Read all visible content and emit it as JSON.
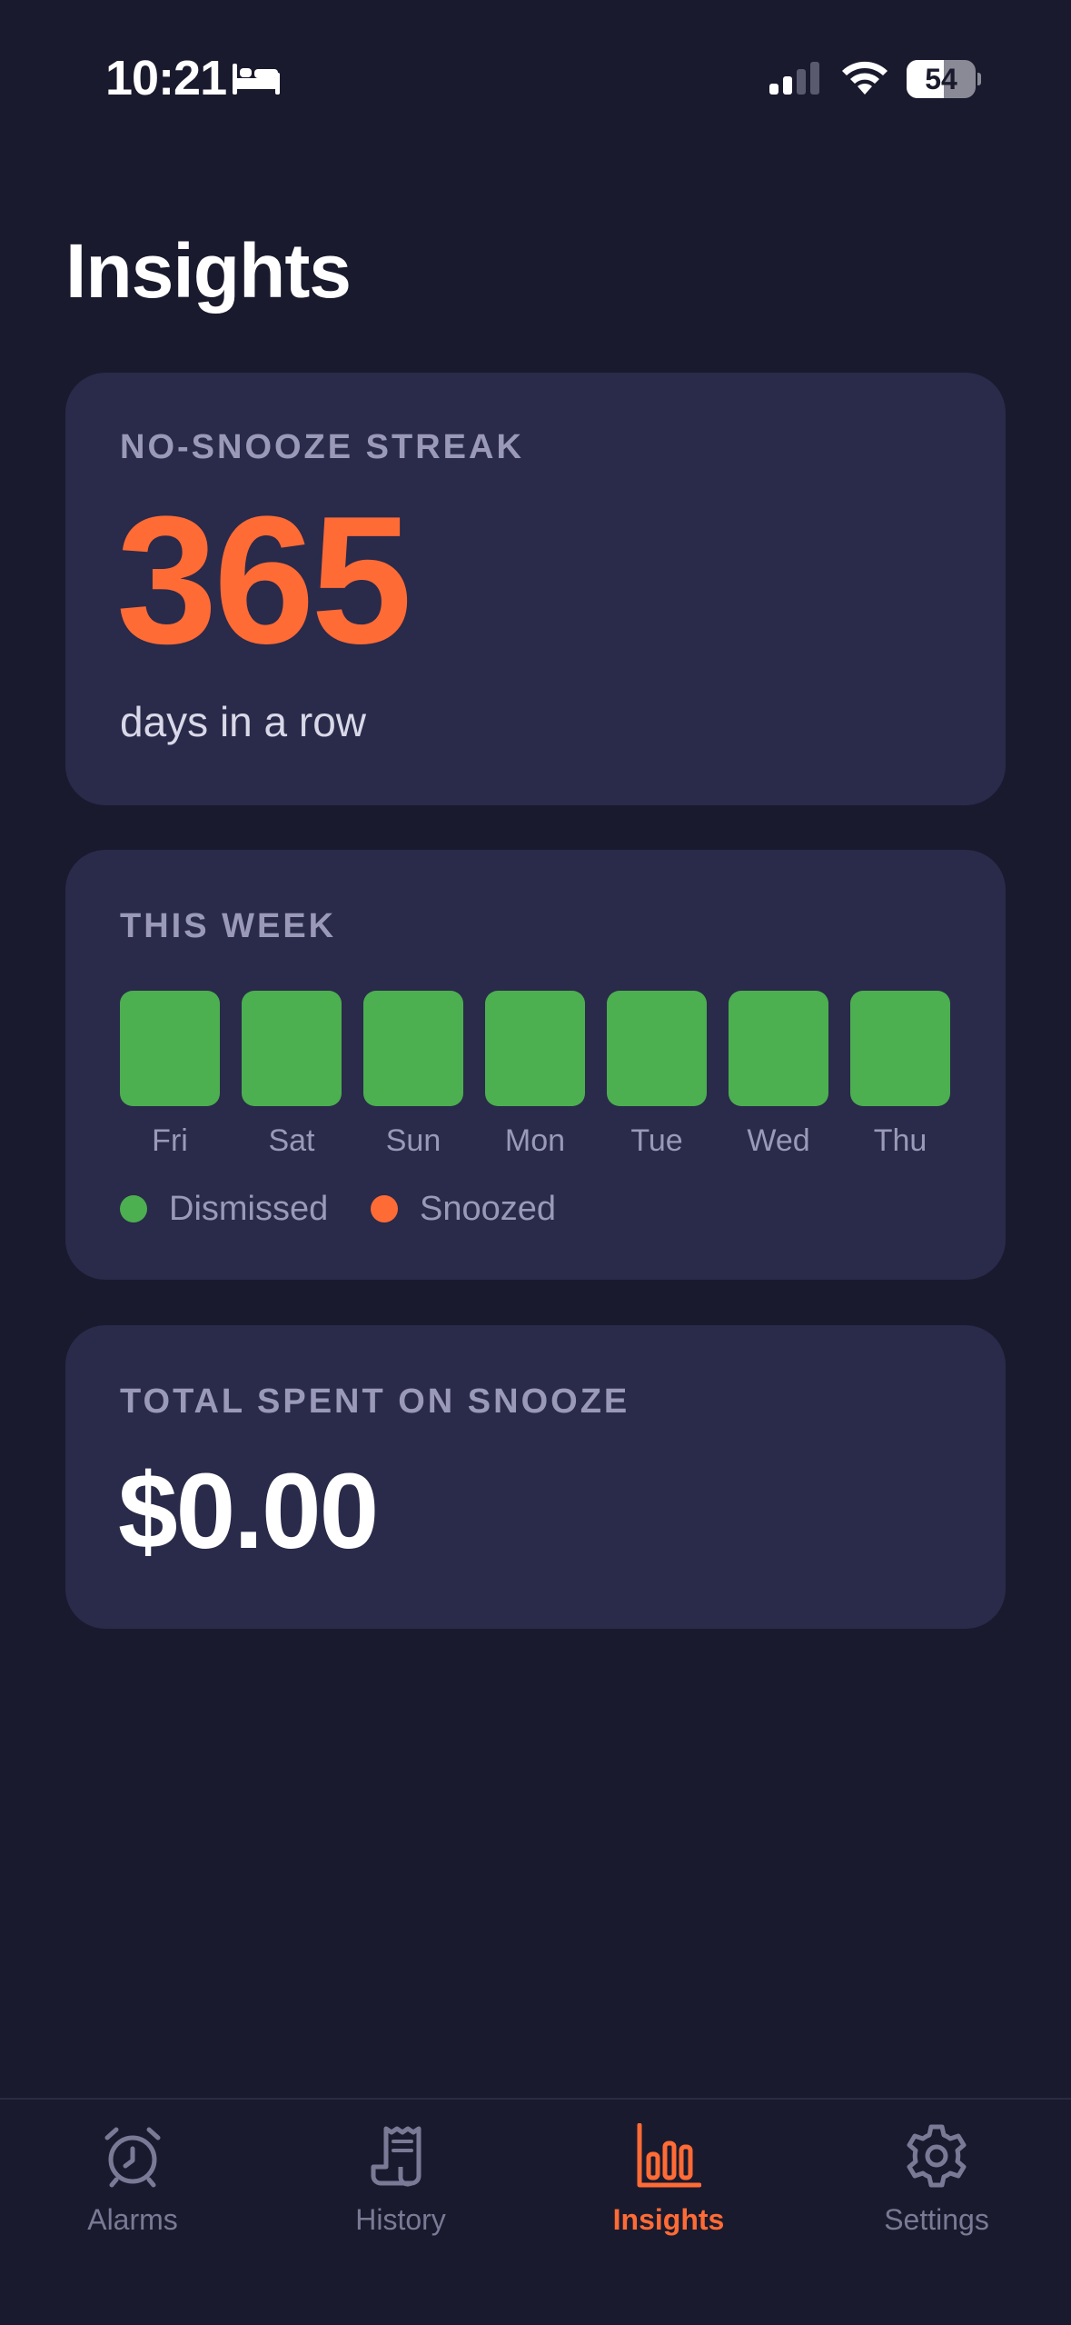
{
  "status_bar": {
    "time": "10:21",
    "battery": "54",
    "battery_level": 0.54
  },
  "page": {
    "title": "Insights"
  },
  "streak_card": {
    "label": "NO-SNOOZE STREAK",
    "value": "365",
    "subtitle": "days in a row",
    "accent_color": "#ff6b35"
  },
  "week_card": {
    "label": "THIS WEEK",
    "days": [
      {
        "label": "Fri",
        "status": "dismissed"
      },
      {
        "label": "Sat",
        "status": "dismissed"
      },
      {
        "label": "Sun",
        "status": "dismissed"
      },
      {
        "label": "Mon",
        "status": "dismissed"
      },
      {
        "label": "Tue",
        "status": "dismissed"
      },
      {
        "label": "Wed",
        "status": "dismissed"
      },
      {
        "label": "Thu",
        "status": "dismissed"
      }
    ],
    "legend": [
      {
        "label": "Dismissed",
        "color": "#4caf50"
      },
      {
        "label": "Snoozed",
        "color": "#ff6b35"
      }
    ]
  },
  "total_card": {
    "label": "TOTAL SPENT ON SNOOZE",
    "value": "$0.00"
  },
  "tab_bar": {
    "tabs": [
      {
        "label": "Alarms",
        "icon": "alarm-clock-icon",
        "active": false
      },
      {
        "label": "History",
        "icon": "receipt-icon",
        "active": false
      },
      {
        "label": "Insights",
        "icon": "bar-chart-icon",
        "active": true
      },
      {
        "label": "Settings",
        "icon": "gear-icon",
        "active": false
      }
    ],
    "active_color": "#ff6b35",
    "inactive_color": "#7a7a96"
  }
}
